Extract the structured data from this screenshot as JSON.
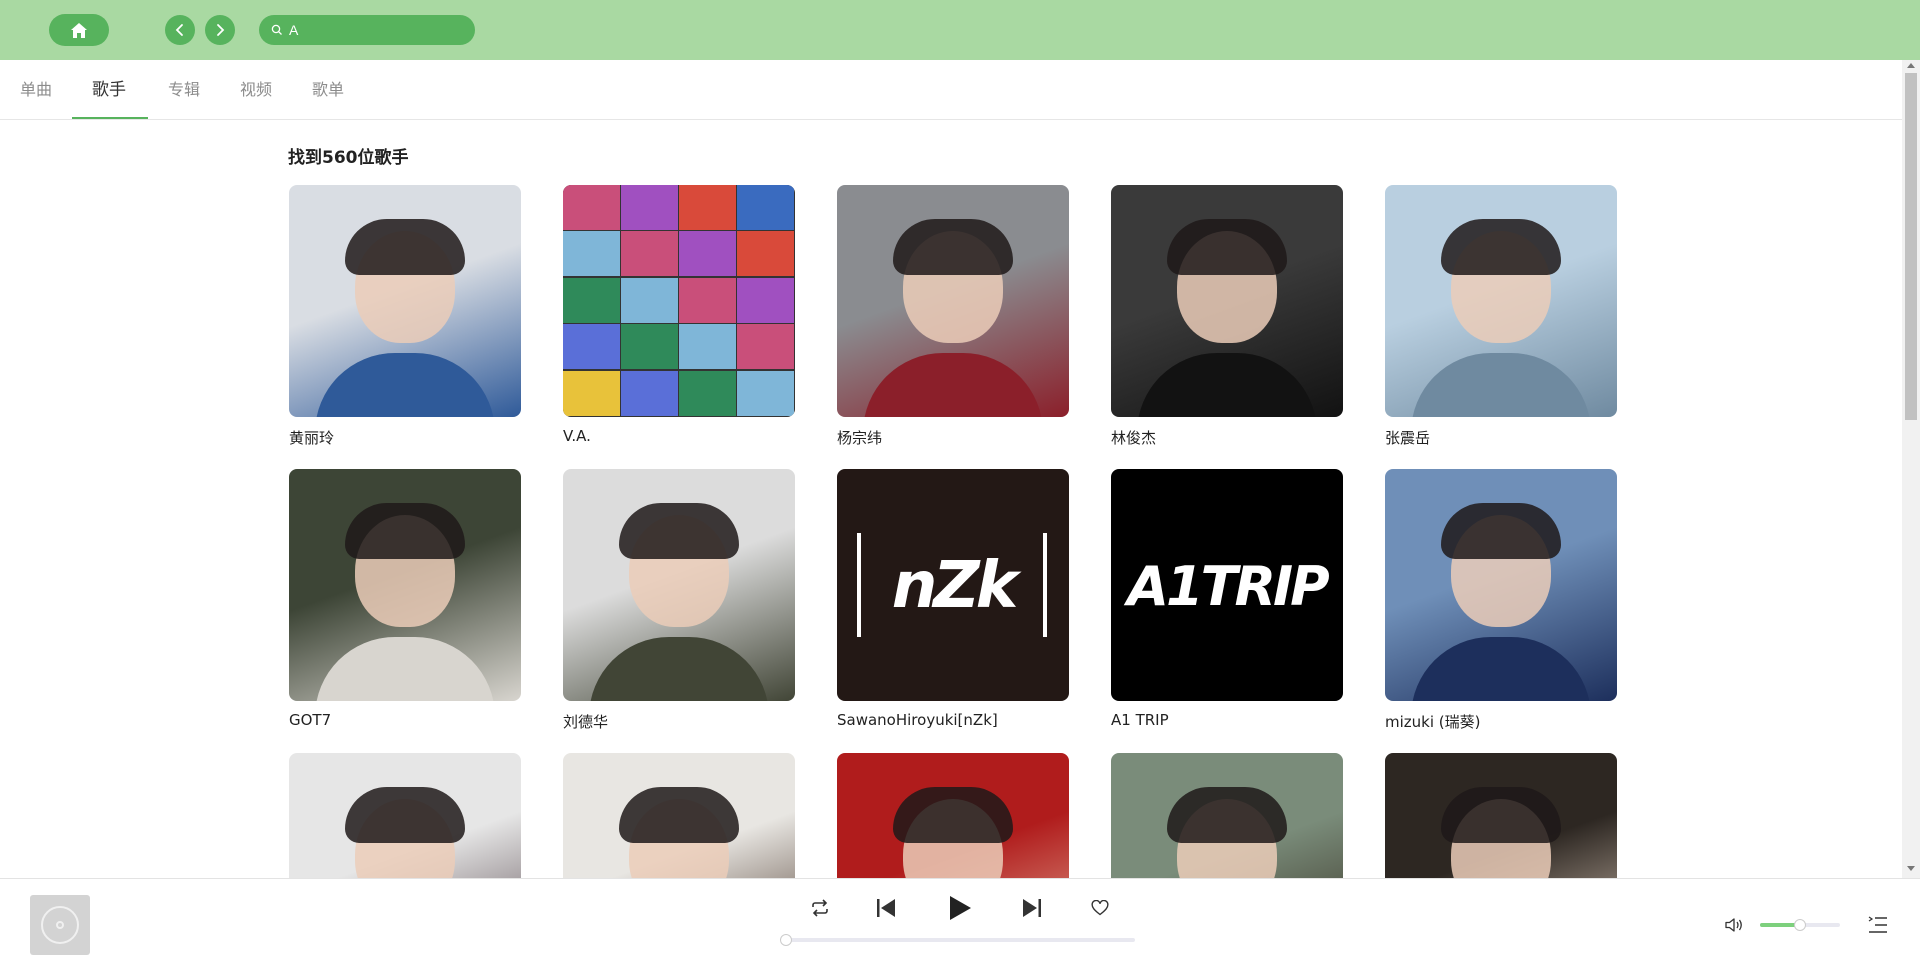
{
  "header": {
    "search_value": "A",
    "colors": {
      "bar": "#a9d9a2",
      "button": "#57b35d"
    }
  },
  "tabs": [
    {
      "label": "单曲",
      "active": false
    },
    {
      "label": "歌手",
      "active": true
    },
    {
      "label": "专辑",
      "active": false
    },
    {
      "label": "视频",
      "active": false
    },
    {
      "label": "歌单",
      "active": false
    }
  ],
  "results": {
    "title": "找到560位歌手",
    "artists": [
      {
        "name": "黄丽玲",
        "image": "artist-photo",
        "colors": [
          "#d9dde3",
          "#2f5a99"
        ]
      },
      {
        "name": "V.A.",
        "image": "album-collage",
        "colors": [
          "#c94f7a",
          "#3a6bbf"
        ]
      },
      {
        "name": "杨宗纬",
        "image": "artist-photo",
        "colors": [
          "#8a8c90",
          "#8b1f2a"
        ]
      },
      {
        "name": "林俊杰",
        "image": "artist-photo",
        "colors": [
          "#3a3a3a",
          "#121212"
        ]
      },
      {
        "name": "张震岳",
        "image": "artist-photo",
        "colors": [
          "#b9cfe0",
          "#6f8aa0"
        ]
      },
      {
        "name": "GOT7",
        "image": "group-photo",
        "colors": [
          "#3d4536",
          "#d8d5cf"
        ]
      },
      {
        "name": "刘德华",
        "image": "artist-photo",
        "colors": [
          "#dcdcdc",
          "#414536"
        ]
      },
      {
        "name": "SawanoHiroyuki[nZk]",
        "image": "logo-nzk",
        "colors": [
          "#231815",
          "#ffffff"
        ]
      },
      {
        "name": "A1 TRIP",
        "image": "logo-a1trip",
        "colors": [
          "#000000",
          "#ffffff"
        ]
      },
      {
        "name": "mizuki (瑞葵)",
        "image": "artist-photo",
        "colors": [
          "#6f8fb8",
          "#1d2f5c"
        ]
      },
      {
        "name": "",
        "image": "artist-photo",
        "colors": [
          "#e6e6e6",
          "#4a3a40"
        ]
      },
      {
        "name": "",
        "image": "artist-photo",
        "colors": [
          "#e8e6e2",
          "#3b2518"
        ]
      },
      {
        "name": "",
        "image": "artist-photo",
        "colors": [
          "#b01c1c",
          "#e8b7a0"
        ]
      },
      {
        "name": "",
        "image": "artist-photo",
        "colors": [
          "#7a8c7a",
          "#2e2418"
        ]
      },
      {
        "name": "",
        "image": "artist-photo",
        "colors": [
          "#2d2722",
          "#e8d5c4"
        ]
      }
    ]
  },
  "player": {
    "progress": 0,
    "volume": 0.5,
    "colors": {
      "volume_fill": "#7dd07d"
    }
  }
}
